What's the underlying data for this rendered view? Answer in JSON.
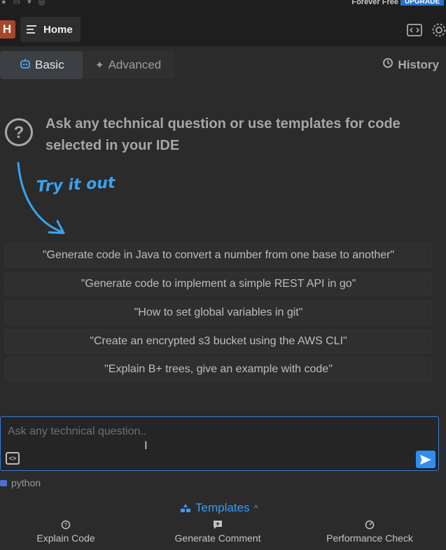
{
  "topbar": {
    "social_icons": [
      "github-icon",
      "discord-icon",
      "twitter-icon",
      "globe-icon"
    ],
    "plan_label": "Forever Free",
    "upgrade_label": "UPGRADE"
  },
  "header": {
    "logo_letter": "H",
    "home_tab_label": "Home",
    "right_icons": [
      "code-window-icon",
      "settings-gear-icon"
    ]
  },
  "modes": {
    "basic_label": "Basic",
    "advanced_label": "Advanced",
    "history_label": "History"
  },
  "intro": {
    "headline_line1": "Ask any technical question or use templates for code",
    "headline_line2": "selected in your IDE",
    "try_it_label": "Try it out"
  },
  "suggestions": [
    "\"Generate code in Java to convert a number from one base to another\"",
    "\"Generate code to implement a simple REST API in go\"",
    "\"How to set global variables in git\"",
    "\"Create an encrypted s3 bucket using the AWS CLI\"",
    "\"Explain B+ trees, give an example with code\""
  ],
  "input": {
    "placeholder": "Ask any technical question..",
    "value": ""
  },
  "language_label": "python",
  "templates_label": "Templates",
  "actions": [
    {
      "label": "Explain Code",
      "icon": "question-circle-icon"
    },
    {
      "label": "Generate Comment",
      "icon": "comment-icon"
    },
    {
      "label": "Performance Check",
      "icon": "gauge-icon"
    }
  ],
  "colors": {
    "accent": "#3c9bf2",
    "upgrade_bg": "#2b73c9",
    "logo_bg": "#a5472a",
    "background": "#2b2b2b"
  }
}
